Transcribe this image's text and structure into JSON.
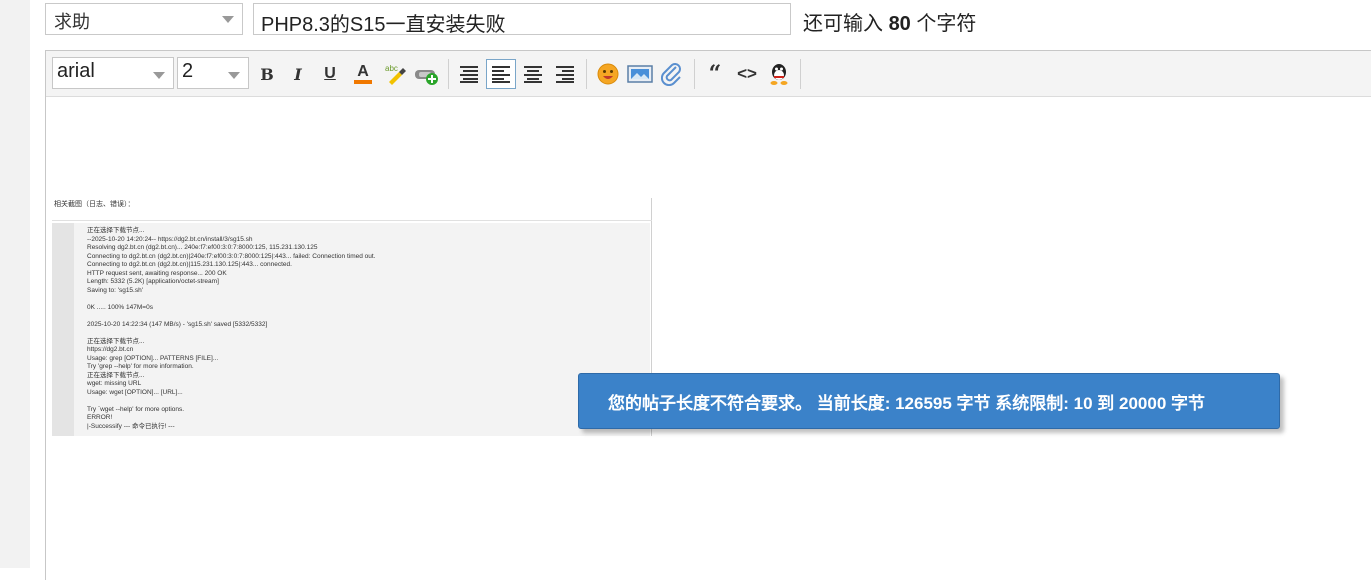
{
  "form": {
    "category": "求助",
    "title_value": "PHP8.3的S15一直安装失败",
    "remaining_prefix": "还可输入",
    "remaining_count": "80",
    "remaining_suffix": "个字符"
  },
  "toolbar": {
    "font_family": "arial",
    "font_size": "2",
    "bold": "B",
    "italic": "I",
    "underline": "U",
    "font_color": "A",
    "quote": "“",
    "code": "<>"
  },
  "attachment": {
    "caption": "相关截图（日志、错误）：",
    "lines": [
      "正在选择下载节点...",
      "--2025-10-20 14:20:24-- https://dg2.bt.cn/install/3/sg15.sh",
      "Resolving dg2.bt.cn (dg2.bt.cn)... 240e:f7:ef00:3:0:7:8000:125, 115.231.130.125",
      "Connecting to dg2.bt.cn (dg2.bt.cn)|240e:f7:ef00:3:0:7:8000:125|:443... failed: Connection timed out.",
      "Connecting to dg2.bt.cn (dg2.bt.cn)|115.231.130.125|:443... connected.",
      "HTTP request sent, awaiting response... 200 OK",
      "Length: 5332 (5.2K) [application/octet-stream]",
      "Saving to: 'sg15.sh'",
      "",
      "0K ..... 100% 147M=0s",
      "",
      "2025-10-20 14:22:34 (147 MB/s) - 'sg15.sh' saved [5332/5332]",
      "",
      "正在选择下载节点...",
      "https://dg2.bt.cn",
      "Usage: grep [OPTION]... PATTERNS [FILE]...",
      "Try 'grep --help' for more information.",
      "正在选择下载节点...",
      "wget: missing URL",
      "Usage: wget [OPTION]... [URL]...",
      "",
      "Try `wget --help' for more options.",
      "ERROR!",
      "|-Successify --- 命令已执行! ---"
    ]
  },
  "toast": {
    "message": "您的帖子长度不符合要求。 当前长度: 126595 字节 系统限制: 10 到 20000 字节"
  },
  "colors": {
    "toast_bg": "#3b82c9",
    "toolbar_bg": "#f4f4f4"
  }
}
